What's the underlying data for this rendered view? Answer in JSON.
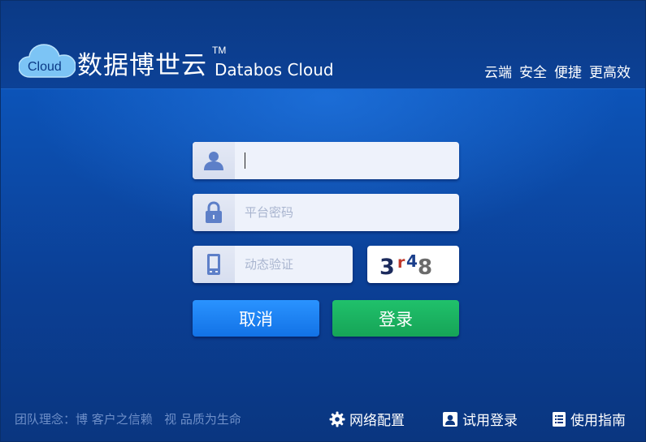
{
  "header": {
    "logo_cloud_text": "Cloud",
    "brand_name_cn": "数据博世云",
    "brand_tm": "TM",
    "brand_name_en": "Databos Cloud",
    "slogan": [
      "云端",
      "安全",
      "便捷",
      "更高效"
    ]
  },
  "form": {
    "username": {
      "value": "",
      "placeholder": ""
    },
    "password": {
      "value": "",
      "placeholder": "平台密码"
    },
    "verify_code": {
      "value": "",
      "placeholder": "动态验证"
    },
    "captcha": {
      "chars": [
        {
          "char": "3",
          "color": "#1b2a5c"
        },
        {
          "char": "r",
          "color": "#c0392b"
        },
        {
          "char": "4",
          "color": "#1b3f8c"
        },
        {
          "char": "8",
          "color": "#6b6b6b"
        }
      ]
    },
    "cancel_label": "取消",
    "login_label": "登录"
  },
  "footer": {
    "motto": "团队理念：博 客户之信赖   视 品质为生命",
    "network_config_label": "网络配置",
    "trial_login_label": "试用登录",
    "user_guide_label": "使用指南"
  },
  "colors": {
    "background": "#0c4fb0",
    "header": "#0b3a86",
    "cancel_button": "#1a80f2",
    "login_button": "#1bb261",
    "input_bg": "#eef2fb",
    "icon_color": "#5d7fc8"
  },
  "icons": {
    "username": "user-icon",
    "password": "lock-icon",
    "verify_code": "phone-icon",
    "network_config": "gear-icon",
    "trial_login": "id-card-icon",
    "user_guide": "document-list-icon"
  }
}
